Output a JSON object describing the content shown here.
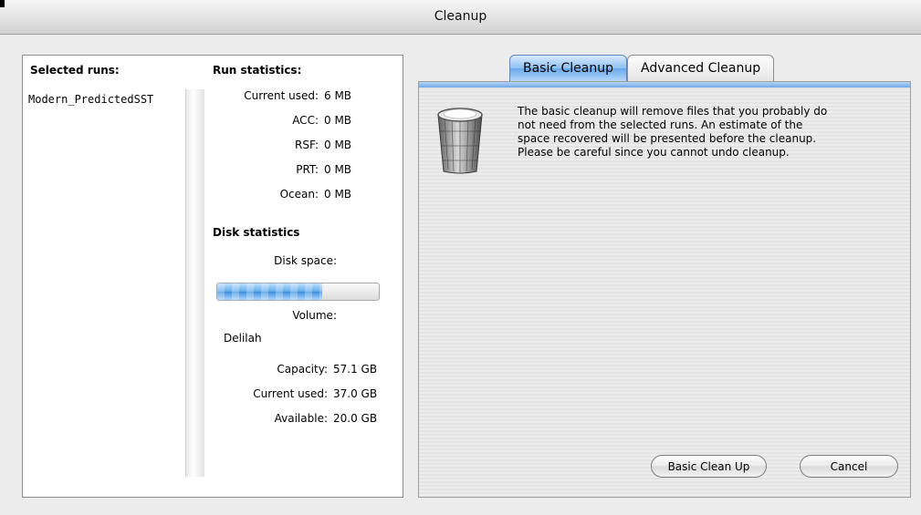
{
  "window": {
    "title": "Cleanup"
  },
  "runs": {
    "header": "Selected runs:",
    "items": [
      "Modern_PredictedSST"
    ]
  },
  "run_statistics": {
    "header": "Run statistics:",
    "rows": [
      {
        "label": "Current used:",
        "value": "6 MB"
      },
      {
        "label": "ACC:",
        "value": "0 MB"
      },
      {
        "label": "RSF:",
        "value": "0 MB"
      },
      {
        "label": "PRT:",
        "value": "0 MB"
      },
      {
        "label": "Ocean:",
        "value": "0 MB"
      }
    ]
  },
  "disk_statistics": {
    "header": "Disk statistics",
    "disk_space_label": "Disk space:",
    "disk_used_fraction": 0.648,
    "volume_label": "Volume:",
    "volume_name": "Delilah",
    "rows": [
      {
        "label": "Capacity:",
        "value": "57.1 GB"
      },
      {
        "label": "Current used:",
        "value": "37.0 GB"
      },
      {
        "label": "Available:",
        "value": "20.0 GB"
      }
    ]
  },
  "tabs": [
    {
      "label": "Basic Cleanup",
      "active": true
    },
    {
      "label": "Advanced Cleanup",
      "active": false
    }
  ],
  "basic": {
    "icon": "trash-can-icon",
    "lines": [
      "The basic cleanup will remove files that you probably do",
      "not need from the selected runs. An estimate of the",
      "space recovered will be presented before the cleanup.",
      "Please be careful since you cannot undo cleanup."
    ],
    "clean_button": "Basic Clean Up",
    "cancel_button": "Cancel"
  },
  "colors": {
    "accent": "#6aa8ec",
    "progress": "#3f8fe0"
  }
}
